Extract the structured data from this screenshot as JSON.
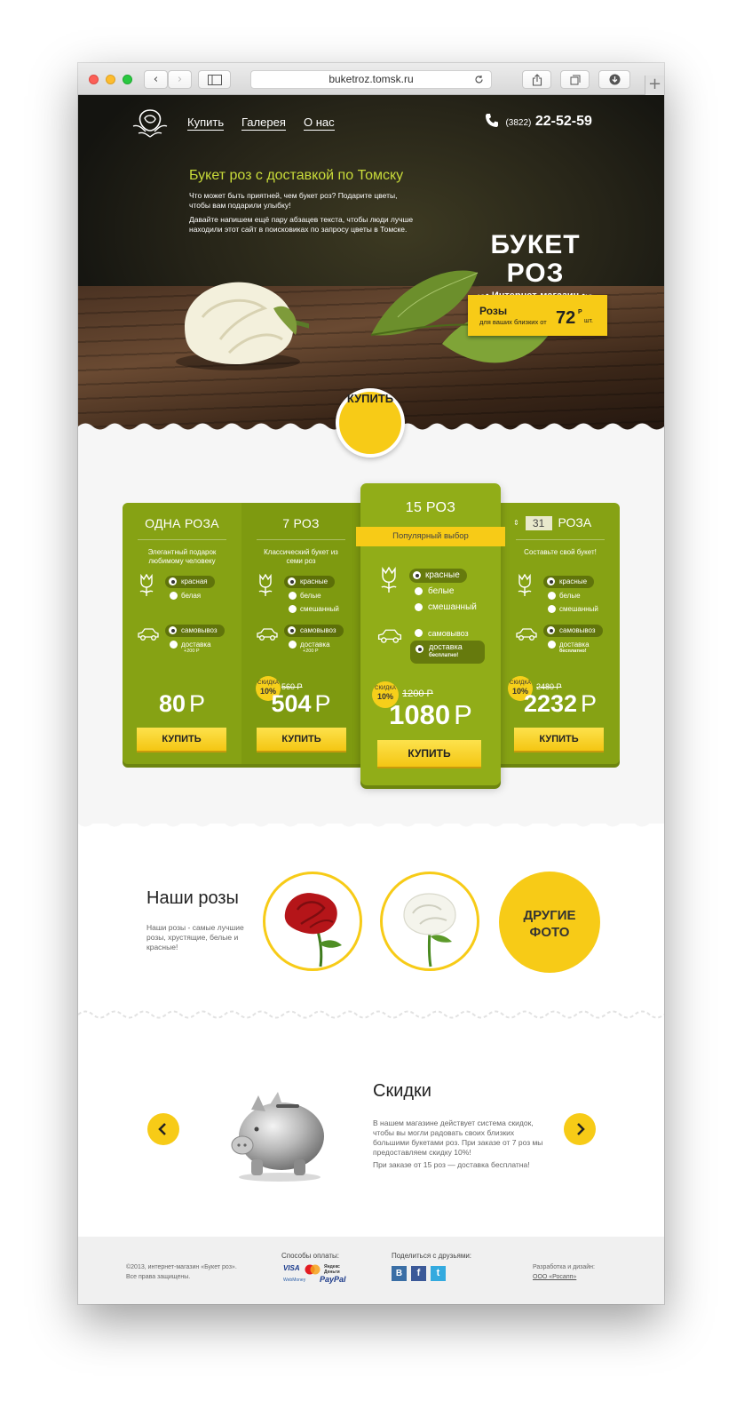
{
  "browser": {
    "url": "buketroz.tomsk.ru"
  },
  "nav": {
    "items": [
      "Купить",
      "Галерея",
      "О нас"
    ],
    "phone_code": "(3822)",
    "phone": "22-52-59"
  },
  "hero": {
    "heading": "Букет роз с доставкой по Томску",
    "para1": "Что может быть приятней, чем букет роз? Подарите цветы, чтобы вам подарили улыбку!",
    "para2": "Давайте напишем ещё пару абзацев текста, чтобы люди лучше находили этот сайт в поисковиках по запросу цветы в Томске.",
    "brand": "БУКЕТ РОЗ",
    "brand_sub": "Интернет-магазин",
    "promo_title": "Розы",
    "promo_sub": "для ваших близких от",
    "promo_price": "72",
    "promo_currency": "Р",
    "promo_unit": "шт.",
    "buy": "КУПИТЬ"
  },
  "pricing": {
    "cards": [
      {
        "title": "ОДНА РОЗА",
        "desc": "Элегантный подарок любимому человеку",
        "colors": [
          "красная",
          "белая"
        ],
        "delivery": [
          "самовывоз",
          "доставка"
        ],
        "delivery_note": "+200 Р",
        "price": "80",
        "currency": "Р",
        "buy": "КУПИТЬ"
      },
      {
        "title": "7 РОЗ",
        "desc": "Классический букет из семи роз",
        "colors": [
          "красные",
          "белые",
          "смешанный"
        ],
        "delivery": [
          "самовывоз",
          "доставка"
        ],
        "delivery_note": "+200 Р",
        "discount_label": "СКИДКА",
        "discount": "10%",
        "old_price": "560 Р",
        "price": "504",
        "currency": "Р",
        "buy": "КУПИТЬ"
      },
      {
        "title": "15 РОЗ",
        "popular": "Популярный выбор",
        "colors": [
          "красные",
          "белые",
          "смешанный"
        ],
        "delivery": [
          "самовывоз",
          "доставка"
        ],
        "delivery_note": "бесплатно!",
        "discount_label": "СКИДКА",
        "discount": "10%",
        "old_price": "1200 Р",
        "price": "1080",
        "currency": "Р",
        "buy": "КУПИТЬ"
      },
      {
        "title": "РОЗА",
        "qty": "31",
        "desc": "Составьте свой букет!",
        "colors": [
          "красные",
          "белые",
          "смешанный"
        ],
        "delivery": [
          "самовывоз",
          "доставка"
        ],
        "delivery_note": "бесплатно!",
        "discount_label": "СКИДКА",
        "discount": "10%",
        "old_price": "2480 Р",
        "price": "2232",
        "currency": "Р",
        "buy": "КУПИТЬ"
      }
    ]
  },
  "roses": {
    "title": "Наши розы",
    "text": "Наши розы - самые лучшие розы, хрустящие, белые и красные!",
    "more": "ДРУГИЕ ФОТО"
  },
  "discounts": {
    "title": "Скидки",
    "text1": "В нашем магазине действует система скидок, чтобы вы могли радовать своих близких большими букетами роз. При заказе от 7 роз мы предоставляем скидку 10%!",
    "text2": "При заказе от 15 роз — доставка бесплатна!"
  },
  "footer": {
    "copy1": "©2013, интернет-магазин «Букет роз».",
    "copy2": "Все права защищены.",
    "payments_title": "Способы оплаты:",
    "payments": [
      "VISA",
      "Яндекс Деньги",
      "WebMoney",
      "PayPal"
    ],
    "share_title": "Поделиться с друзьями:",
    "share": [
      "В",
      "f",
      "t"
    ],
    "dev_title": "Разработка и дизайн:",
    "dev": "ООО «Росапп»"
  },
  "colors": {
    "green": "#86a214",
    "yellow": "#f7cb17",
    "dark": "#1e1d14"
  }
}
